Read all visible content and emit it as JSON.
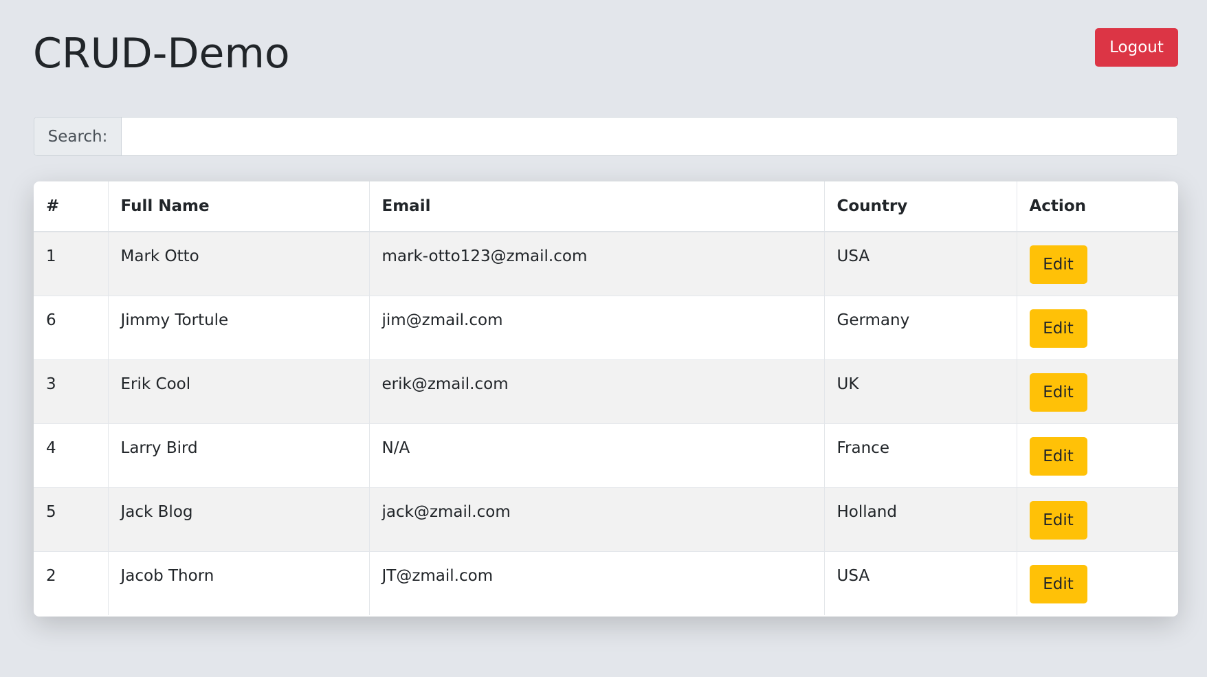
{
  "header": {
    "title": "CRUD-Demo",
    "logout_label": "Logout"
  },
  "search": {
    "label": "Search:",
    "value": ""
  },
  "table": {
    "columns": [
      "#",
      "Full Name",
      "Email",
      "Country",
      "Action"
    ],
    "rows": [
      {
        "id": "1",
        "name": "Mark Otto",
        "email": "mark-otto123@zmail.com",
        "country": "USA",
        "action": "Edit"
      },
      {
        "id": "6",
        "name": "Jimmy Tortule",
        "email": "jim@zmail.com",
        "country": "Germany",
        "action": "Edit"
      },
      {
        "id": "3",
        "name": "Erik Cool",
        "email": "erik@zmail.com",
        "country": "UK",
        "action": "Edit"
      },
      {
        "id": "4",
        "name": "Larry Bird",
        "email": "N/A",
        "country": "France",
        "action": "Edit"
      },
      {
        "id": "5",
        "name": "Jack Blog",
        "email": "jack@zmail.com",
        "country": "Holland",
        "action": "Edit"
      },
      {
        "id": "2",
        "name": "Jacob Thorn",
        "email": "JT@zmail.com",
        "country": "USA",
        "action": "Edit"
      }
    ]
  },
  "colors": {
    "background": "#e3e6eb",
    "logout": "#dc3545",
    "edit": "#ffc107",
    "row_striped": "#f2f2f2"
  }
}
